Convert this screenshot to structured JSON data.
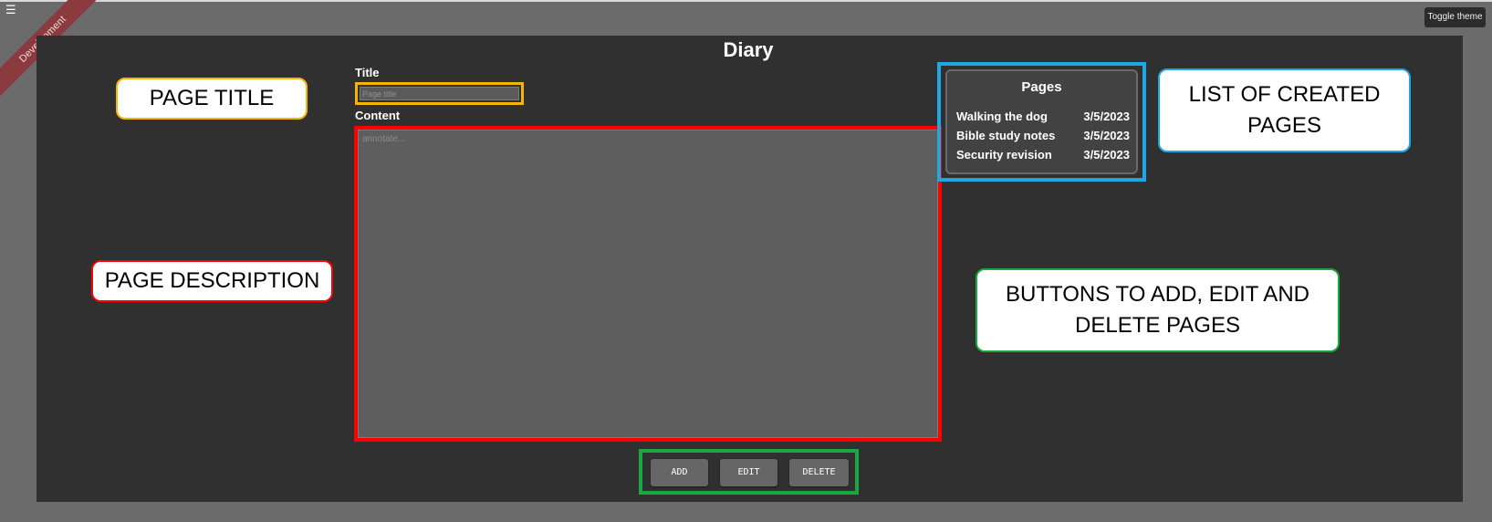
{
  "menu": {
    "icon": "hamburger-icon",
    "glyph": "☰"
  },
  "ribbon": {
    "label": "Development"
  },
  "header": {
    "toggle_theme_label": "Toggle theme",
    "title": "Diary"
  },
  "form": {
    "title_label": "Title",
    "title_placeholder": "Page title",
    "title_value": "",
    "content_label": "Content",
    "content_placeholder": "annotate...",
    "content_value": ""
  },
  "actions": {
    "add_label": "ADD",
    "edit_label": "EDIT",
    "delete_label": "DELETE"
  },
  "pages": {
    "heading": "Pages",
    "items": [
      {
        "name": "Walking the dog",
        "date": "3/5/2023"
      },
      {
        "name": "Bible study notes",
        "date": "3/5/2023"
      },
      {
        "name": "Security revision",
        "date": "3/5/2023"
      }
    ]
  },
  "annotations": {
    "page_title": "PAGE TITLE",
    "page_description": "PAGE DESCRIPTION",
    "list_of_pages": "LIST OF CREATED PAGES",
    "buttons": "BUTTONS TO ADD, EDIT AND DELETE PAGES"
  },
  "colors": {
    "title_highlight": "#f2b705",
    "content_highlight": "#ff0000",
    "buttons_highlight": "#1aa843",
    "pages_highlight": "#1ea7e1",
    "ribbon": "#8b3a3e",
    "panel": "#303030"
  }
}
